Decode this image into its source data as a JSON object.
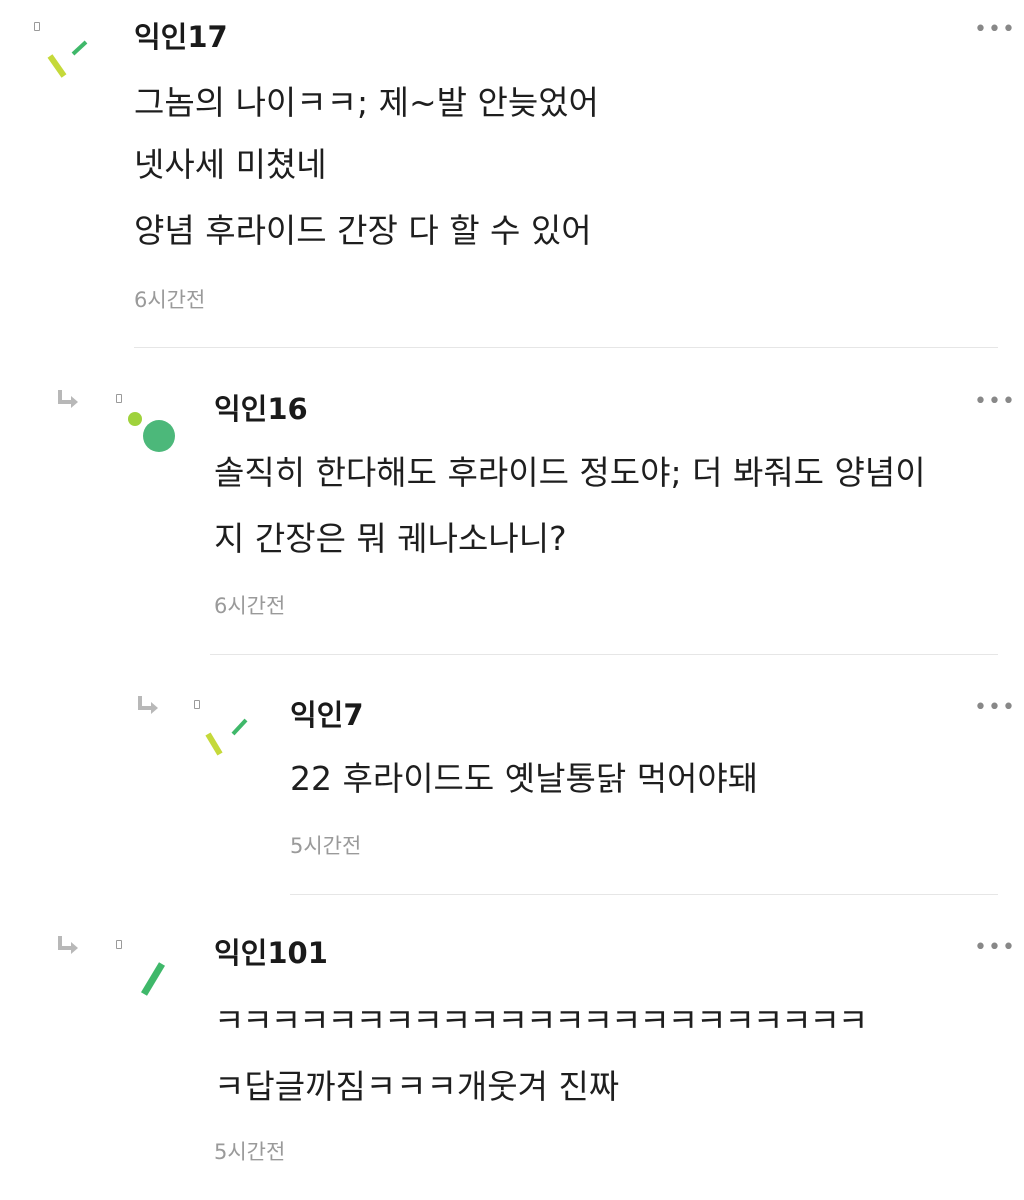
{
  "comments": [
    {
      "nickname": "익인17",
      "lines": [
        "그놈의 나이ㅋㅋ; 제~발 안늦었어",
        "넷사세 미쳤네",
        "양념 후라이드 간장 다 할 수 있어"
      ],
      "time": "6시간전",
      "avatar": "yellow-green-slash-marks",
      "is_reply": false
    },
    {
      "nickname": "익인16",
      "lines": [
        "솔직히 한다해도 후라이드 정도야; 더 봐줘도 양념이",
        "지 간장은 뭐 궤나소나니?"
      ],
      "time": "6시간전",
      "avatar": "green-dot-circle",
      "is_reply": true
    },
    {
      "nickname": "익인7",
      "lines": [
        "22 후라이드도 옛날통닭 먹어야돼"
      ],
      "time": "5시간전",
      "avatar": "yellow-green-slash-marks",
      "is_reply": true
    },
    {
      "nickname": "익인101",
      "lines": [
        "ㅋㅋㅋㅋㅋㅋㅋㅋㅋㅋㅋㅋㅋㅋㅋㅋㅋㅋㅋㅋㅋㅋㅋ",
        "ㅋ답글까짐ㅋㅋㅋ개웃겨 진짜"
      ],
      "time": "5시간전",
      "avatar": "green-slash-mark",
      "is_reply": true
    }
  ],
  "icons": {
    "more": "more-dots-icon",
    "reply": "reply-arrow-icon",
    "badge": "user-badge-icon"
  },
  "colors": {
    "yellow_green": "#c5d93a",
    "green": "#3fb86a",
    "light_green": "#9fd23c",
    "circle_green": "#4cb87a",
    "text": "#1e1e1e",
    "meta": "#9a9a9a",
    "divider": "#e6e6e6"
  }
}
